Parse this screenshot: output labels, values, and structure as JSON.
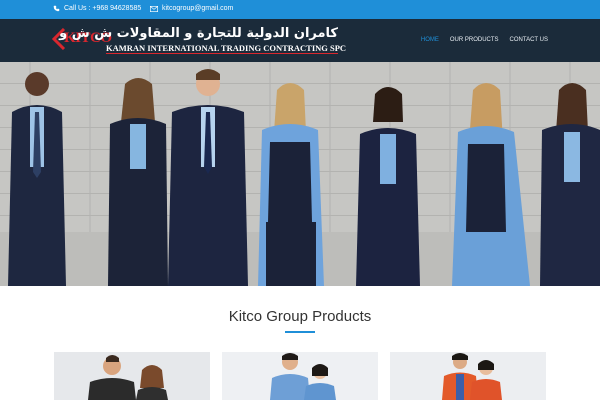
{
  "topbar": {
    "phone": "Call Us : +968 94628585",
    "email": "kitcogroup@gmail.com"
  },
  "header": {
    "logo_brand": "KITCO",
    "logo_arabic": "كامران الدولية للتجارة و المقاولات ش ش و",
    "logo_english": "KAMRAN INTERNATIONAL TRADING CONTRACTING SPC"
  },
  "nav": {
    "items": [
      {
        "label": "HOME",
        "active": true
      },
      {
        "label": "OUR PRODUCTS",
        "active": false
      },
      {
        "label": "CONTACT US",
        "active": false
      }
    ]
  },
  "products": {
    "title": "Kitco Group Products"
  },
  "colors": {
    "topbar": "#1f8fd8",
    "header": "#1b2b3a",
    "accent": "#1f8fd8",
    "brand_red": "#d9272e"
  }
}
